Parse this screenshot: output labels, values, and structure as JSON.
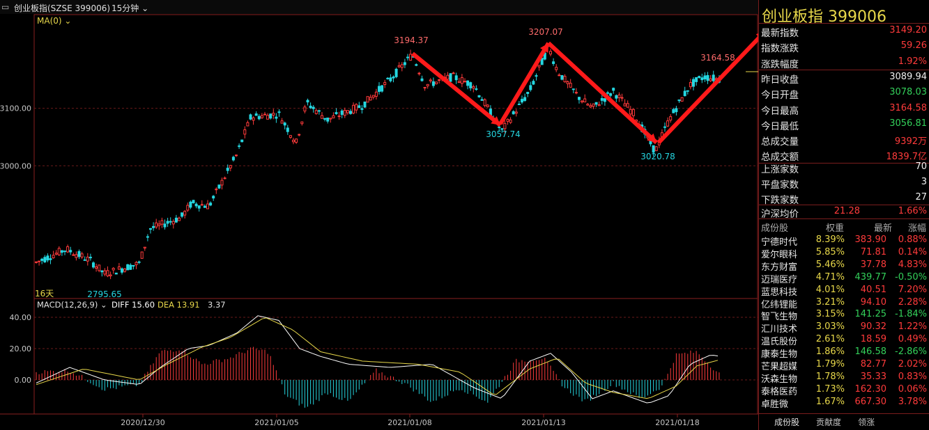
{
  "toolbar": {
    "symbol": "创业板指(SZSE 399006)",
    "period": "15分钟"
  },
  "ma_label": "MA(0)",
  "days_label": "16天",
  "macd_legend": {
    "name": "MACD(12,26,9)",
    "diff": "DIFF 15.60",
    "dea": "DEA 13.91",
    "macd": "3.37"
  },
  "price_ticks": [
    "3100.00",
    "3000.00"
  ],
  "macd_ticks": [
    "40.00",
    "20.00",
    "0.00"
  ],
  "date_ticks": [
    "2020/12/30",
    "2021/01/05",
    "2021/01/08",
    "2021/01/13",
    "2021/01/18"
  ],
  "annotations": [
    "3194.37",
    "3057.74",
    "3207.07",
    "3020.78",
    "3164.58",
    "2795.65"
  ],
  "chart_data": {
    "type": "line",
    "x": [
      "2020/12/30",
      "2021/01/05",
      "2021/01/08",
      "2021/01/13",
      "2021/01/18"
    ],
    "series": [
      {
        "values": [
          2830,
          3085,
          3145,
          3120,
          3150
        ]
      }
    ],
    "ylim": [
      2780,
      3240
    ],
    "points": [
      {
        "x": "2020/12/28",
        "y": 2832
      },
      {
        "x": "2020/12/29",
        "y": 2855
      },
      {
        "x": "2020/12/30",
        "y": 2812
      },
      {
        "x": "2020/12/31",
        "y": 2900
      },
      {
        "x": "2021/01/04",
        "y": 2980
      },
      {
        "x": "2021/01/05",
        "y": 3085
      },
      {
        "x": "2021/01/06",
        "y": 3090
      },
      {
        "x": "2021/01/07",
        "y": 3130
      },
      {
        "x": "2021/01/08",
        "y": 3180
      },
      {
        "x": "2021/01/11",
        "y": 3060
      },
      {
        "x": "2021/01/12",
        "y": 3190
      },
      {
        "x": "2021/01/13",
        "y": 3120
      },
      {
        "x": "2021/01/14",
        "y": 3090
      },
      {
        "x": "2021/01/15",
        "y": 3030
      },
      {
        "x": "2021/01/18",
        "y": 3120
      },
      {
        "x": "2021/01/19",
        "y": 3155
      }
    ]
  },
  "quote": {
    "title": "创业板指  399006",
    "rows": [
      {
        "label": "最新指数",
        "value": "3149.20",
        "color": "#ff3b3b"
      },
      {
        "label": "指数涨跌",
        "value": "59.26",
        "color": "#ff3b3b"
      },
      {
        "label": "涨跌幅度",
        "value": "1.92%",
        "color": "#ff3b3b"
      },
      {
        "label": "昨日收盘",
        "value": "3089.94",
        "color": "#f0f0f0"
      },
      {
        "label": "今日开盘",
        "value": "3078.03",
        "color": "#33d05a"
      },
      {
        "label": "今日最高",
        "value": "3164.58",
        "color": "#ff3b3b"
      },
      {
        "label": "今日最低",
        "value": "3056.81",
        "color": "#33d05a"
      },
      {
        "label": "总成交量",
        "value": "9392万",
        "color": "#ff3b3b"
      },
      {
        "label": "总成交额",
        "value": "1839.7亿",
        "color": "#ff3b3b"
      }
    ],
    "breadth": [
      {
        "label": "上涨家数",
        "value": "70"
      },
      {
        "label": "平盘家数",
        "value": "3"
      },
      {
        "label": "下跌家数",
        "value": "27"
      }
    ],
    "avg": {
      "label": "沪深均价",
      "price": "21.28",
      "pct": "1.66%"
    }
  },
  "components": {
    "headers": [
      "成份股",
      "权重",
      "最新",
      "涨幅"
    ],
    "rows": [
      [
        "宁德时代",
        "8.39%",
        "383.90",
        "0.88%",
        "up"
      ],
      [
        "爱尔眼科",
        "5.85%",
        "71.81",
        "0.14%",
        "up"
      ],
      [
        "东方财富",
        "5.46%",
        "37.78",
        "4.83%",
        "up"
      ],
      [
        "迈瑞医疗",
        "4.71%",
        "439.77",
        "-0.50%",
        "down"
      ],
      [
        "蓝思科技",
        "4.01%",
        "40.51",
        "7.20%",
        "up"
      ],
      [
        "亿纬锂能",
        "3.21%",
        "94.10",
        "2.28%",
        "up"
      ],
      [
        "智飞生物",
        "3.15%",
        "141.25",
        "-1.84%",
        "down"
      ],
      [
        "汇川技术",
        "3.03%",
        "90.32",
        "1.22%",
        "up"
      ],
      [
        "温氏股份",
        "2.61%",
        "18.59",
        "0.49%",
        "up"
      ],
      [
        "康泰生物",
        "1.86%",
        "146.58",
        "-2.86%",
        "down"
      ],
      [
        "芒果超媒",
        "1.79%",
        "82.77",
        "2.02%",
        "up"
      ],
      [
        "沃森生物",
        "1.78%",
        "35.33",
        "0.83%",
        "up"
      ],
      [
        "泰格医药",
        "1.73%",
        "162.30",
        "0.06%",
        "up"
      ],
      [
        "卓胜微",
        "1.67%",
        "667.30",
        "3.78%",
        "up"
      ]
    ]
  },
  "tabs": [
    "成份股",
    "贡献度",
    "领涨"
  ]
}
